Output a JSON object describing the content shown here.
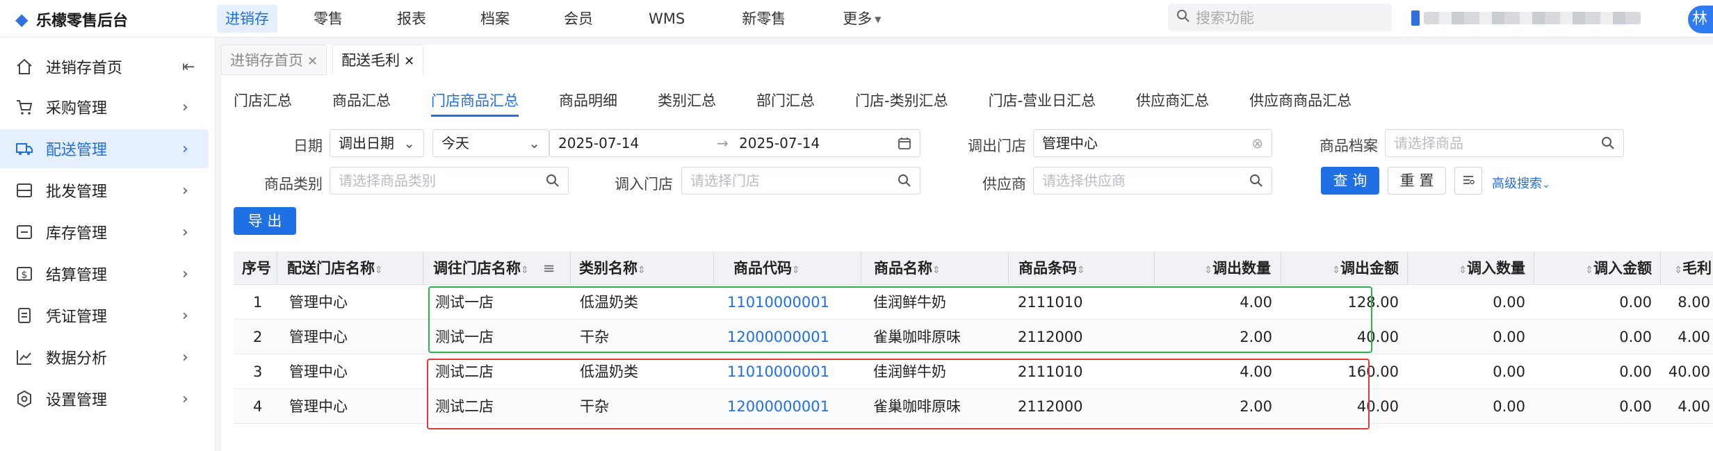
{
  "app": {
    "logo": "乐檬零售后台"
  },
  "topnav": [
    {
      "label": "进销存",
      "active": true
    },
    {
      "label": "零售"
    },
    {
      "label": "报表"
    },
    {
      "label": "档案"
    },
    {
      "label": "会员"
    },
    {
      "label": "WMS"
    },
    {
      "label": "新零售"
    },
    {
      "label": "更多"
    }
  ],
  "search": {
    "placeholder": "搜索功能"
  },
  "user": {
    "avatar": "林"
  },
  "sidebar": [
    {
      "label": "进销存首页",
      "icon": "home-icon"
    },
    {
      "label": "采购管理",
      "icon": "cart-icon"
    },
    {
      "label": "配送管理",
      "icon": "truck-icon",
      "active": true
    },
    {
      "label": "批发管理",
      "icon": "wholesale-icon"
    },
    {
      "label": "库存管理",
      "icon": "inventory-icon"
    },
    {
      "label": "结算管理",
      "icon": "dollar-icon"
    },
    {
      "label": "凭证管理",
      "icon": "voucher-icon"
    },
    {
      "label": "数据分析",
      "icon": "chart-icon"
    },
    {
      "label": "设置管理",
      "icon": "settings-icon"
    }
  ],
  "pagetabs": [
    {
      "label": "进销存首页",
      "active": false
    },
    {
      "label": "配送毛利",
      "active": true
    }
  ],
  "subtabs": [
    "门店汇总",
    "商品汇总",
    "门店商品汇总",
    "商品明细",
    "类别汇总",
    "部门汇总",
    "门店-类别汇总",
    "门店-营业日汇总",
    "供应商汇总",
    "供应商商品汇总"
  ],
  "filters": {
    "date_label": "日期",
    "date_type": "调出日期",
    "date_preset": "今天",
    "date_start": "2025-07-14",
    "date_arrow": "→",
    "date_end": "2025-07-14",
    "out_store_label": "调出门店",
    "out_store_value": "管理中心",
    "goods_label": "商品档案",
    "goods_placeholder": "请选择商品",
    "category_label": "商品类别",
    "category_placeholder": "请选择商品类别",
    "in_store_label": "调入门店",
    "in_store_placeholder": "请选择门店",
    "supplier_label": "供应商",
    "supplier_placeholder": "请选择供应商",
    "query_button": "查 询",
    "reset_button": "重 置",
    "advanced_search": "高级搜索"
  },
  "export_button": "导 出",
  "table": {
    "columns": [
      "序号",
      "配送门店名称",
      "调往门店名称",
      "类别名称",
      "商品代码",
      "商品名称",
      "商品条码",
      "调出数量",
      "调出金额",
      "调入数量",
      "调入金额",
      "毛利"
    ],
    "rows": [
      [
        "1",
        "管理中心",
        "测试一店",
        "低温奶类",
        "11010000001",
        "佳润鲜牛奶",
        "2111010",
        "4.00",
        "128.00",
        "0.00",
        "0.00",
        "8.00"
      ],
      [
        "2",
        "管理中心",
        "测试一店",
        "干杂",
        "12000000001",
        "雀巢咖啡原味",
        "2112000",
        "2.00",
        "40.00",
        "0.00",
        "0.00",
        "4.00"
      ],
      [
        "3",
        "管理中心",
        "测试二店",
        "低温奶类",
        "11010000001",
        "佳润鲜牛奶",
        "2111010",
        "4.00",
        "160.00",
        "0.00",
        "0.00",
        "40.00"
      ],
      [
        "4",
        "管理中心",
        "测试二店",
        "干杂",
        "12000000001",
        "雀巢咖啡原味",
        "2112000",
        "2.00",
        "40.00",
        "0.00",
        "0.00",
        "4.00"
      ]
    ]
  },
  "colors": {
    "accent": "#1f6fe5",
    "highlight_green": "#2fb14a",
    "highlight_red": "#e53935"
  }
}
